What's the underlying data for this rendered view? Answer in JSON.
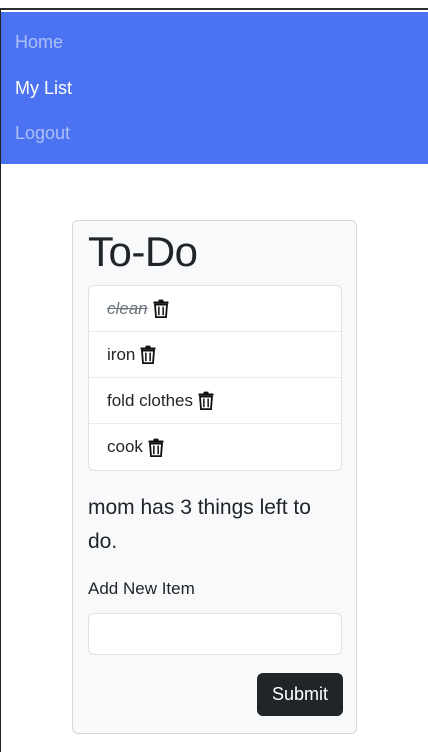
{
  "nav": {
    "items": [
      {
        "label": "Home",
        "active": false
      },
      {
        "label": "My List",
        "active": true
      },
      {
        "label": "Logout",
        "active": false
      }
    ]
  },
  "card": {
    "title": "To-Do",
    "items": [
      {
        "text": "clean",
        "done": true,
        "icon": "trash-icon"
      },
      {
        "text": "iron",
        "done": false,
        "icon": "trash-icon"
      },
      {
        "text": "fold clothes",
        "done": false,
        "icon": "trash-icon"
      },
      {
        "text": "cook",
        "done": false,
        "icon": "trash-icon"
      }
    ],
    "status": "mom has 3 things left to do.",
    "add_label": "Add New Item",
    "add_value": "",
    "submit_label": "Submit"
  },
  "colors": {
    "navbar": "#4b72f0",
    "submit": "#212529",
    "card_bg": "#f8f9fa"
  }
}
